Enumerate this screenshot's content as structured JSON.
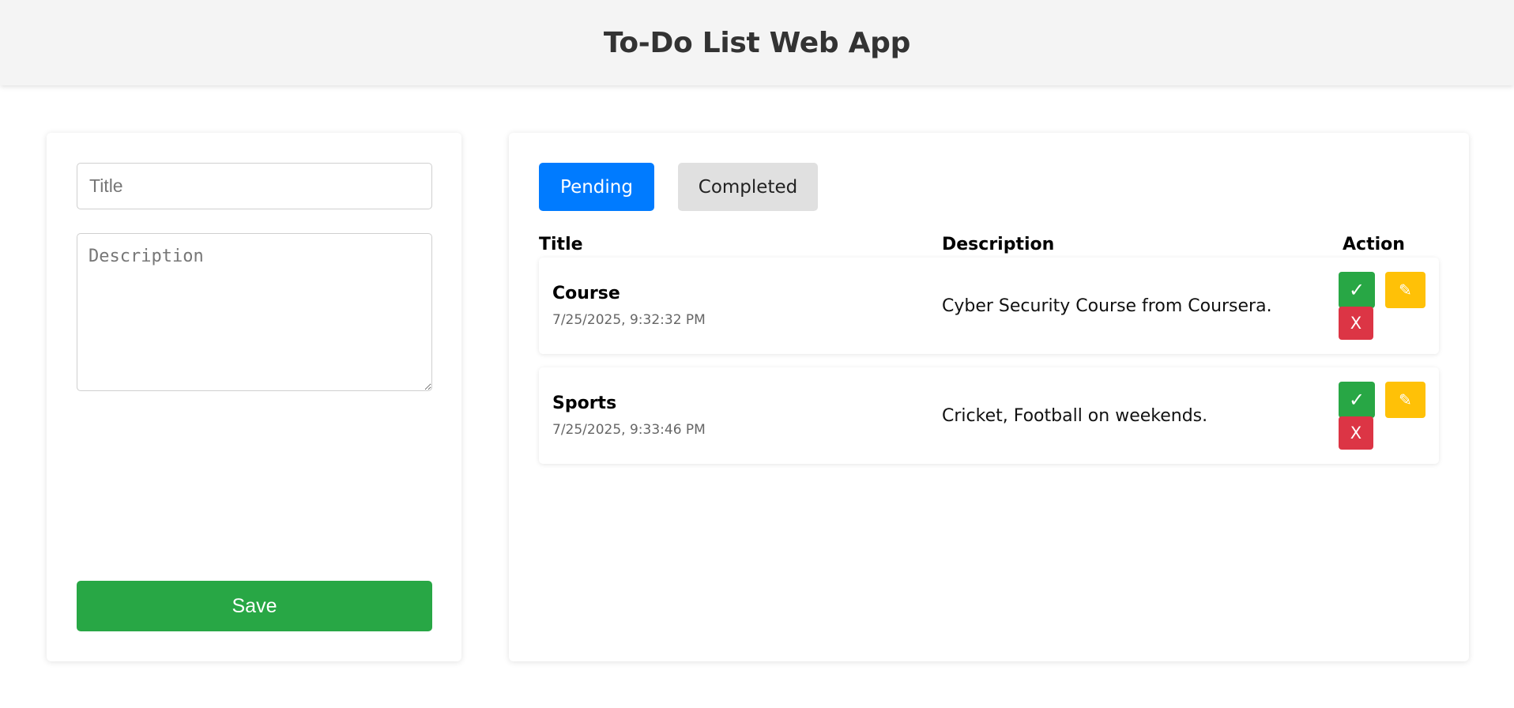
{
  "header": {
    "title": "To-Do List Web App"
  },
  "form": {
    "title_placeholder": "Title",
    "title_value": "",
    "description_placeholder": "Description",
    "description_value": "",
    "save_label": "Save"
  },
  "tabs": {
    "pending_label": "Pending",
    "completed_label": "Completed",
    "active": "Pending"
  },
  "table": {
    "headers": {
      "title": "Title",
      "description": "Description",
      "action": "Action"
    },
    "rows": [
      {
        "title": "Course",
        "timestamp": "7/25/2025, 9:32:32 PM",
        "description": "Cyber Security Course from Coursera."
      },
      {
        "title": "Sports",
        "timestamp": "7/25/2025, 9:33:46 PM",
        "description": "Cricket, Football on weekends."
      }
    ]
  },
  "actions": {
    "complete_symbol": "✓",
    "edit_symbol": "✎",
    "delete_symbol": "X"
  },
  "colors": {
    "primary": "#007bff",
    "success": "#28a745",
    "warning": "#ffc107",
    "danger": "#dc3545",
    "header_bg": "#f4f4f4"
  }
}
